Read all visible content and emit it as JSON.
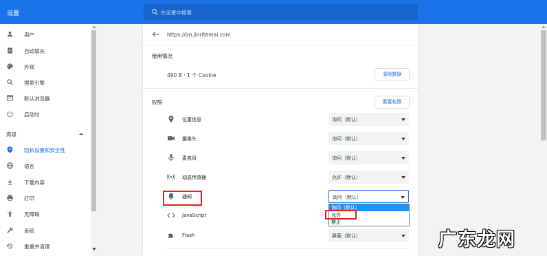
{
  "header": {
    "title": "设置",
    "search_placeholder": "在设置中搜索"
  },
  "sidebar": {
    "items": [
      {
        "label": "用户",
        "icon": "person-icon"
      },
      {
        "label": "自动填充",
        "icon": "clipboard-icon"
      },
      {
        "label": "外观",
        "icon": "palette-icon"
      },
      {
        "label": "搜索引擎",
        "icon": "search-icon"
      },
      {
        "label": "默认浏览器",
        "icon": "browser-icon"
      },
      {
        "label": "启动时",
        "icon": "power-icon"
      }
    ],
    "advanced_label": "高级",
    "advanced_items": [
      {
        "label": "隐私设置和安全性",
        "icon": "shield-icon",
        "active": true
      },
      {
        "label": "语言",
        "icon": "globe-icon"
      },
      {
        "label": "下载内容",
        "icon": "download-icon"
      },
      {
        "label": "打印",
        "icon": "print-icon"
      },
      {
        "label": "无障碍",
        "icon": "accessibility-icon"
      },
      {
        "label": "系统",
        "icon": "wrench-icon"
      },
      {
        "label": "重置并清理",
        "icon": "history-icon"
      }
    ]
  },
  "site": {
    "url": "https://im.jinritemai.com"
  },
  "usage": {
    "title": "使用情况",
    "value": "490 B · 1 个 Cookie",
    "clear_button": "清除数据"
  },
  "permissions": {
    "title": "权限",
    "reset_button": "重置权限",
    "rows": [
      {
        "label": "位置信息",
        "icon": "location-icon",
        "value": "询问（默认）"
      },
      {
        "label": "摄像头",
        "icon": "camera-icon",
        "value": "询问（默认）"
      },
      {
        "label": "麦克风",
        "icon": "microphone-icon",
        "value": "询问（默认）"
      },
      {
        "label": "动态传感器",
        "icon": "sensor-icon",
        "value": "允许（默认）"
      },
      {
        "label": "通知",
        "icon": "bell-icon",
        "value": "询问（默认）"
      },
      {
        "label": "JavaScript",
        "icon": "code-icon",
        "value": ""
      },
      {
        "label": "Flash",
        "icon": "puzzle-icon",
        "value": "屏蔽（默认）"
      }
    ]
  },
  "dropdown_options": [
    "询问（默认）",
    "允许",
    "禁止"
  ],
  "watermark": "广东龙网",
  "colors": {
    "brand": "#1a73e8",
    "highlight": "#e2231a"
  }
}
